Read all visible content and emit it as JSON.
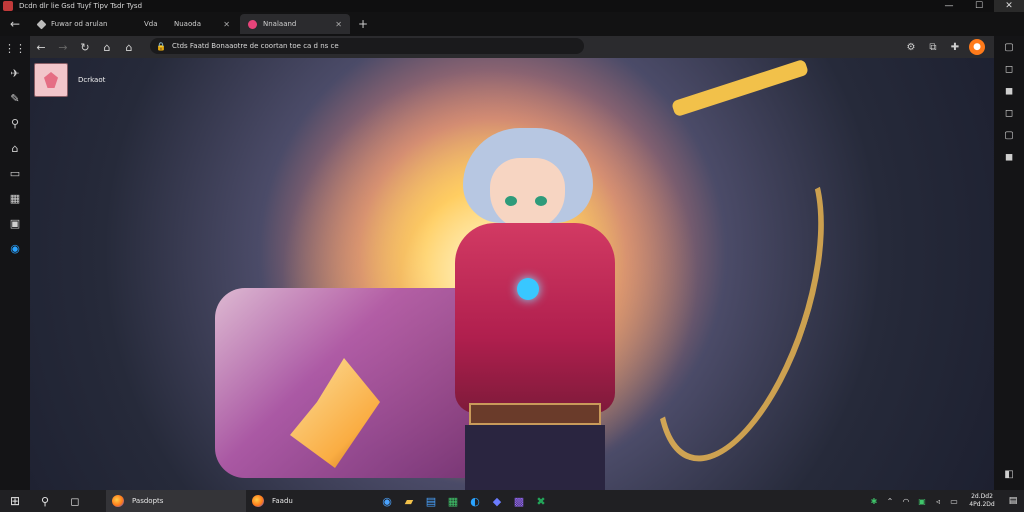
{
  "window": {
    "title": "Dcdn dlr lie Gsd  Tuyf Tipv Tsdr Tysd",
    "controls": {
      "minimize": "—",
      "maximize": "☐",
      "close": "✕"
    }
  },
  "tabs": [
    {
      "label": "Fuwar od arulan",
      "active": false
    },
    {
      "label": "Vda",
      "active": false
    },
    {
      "label": "Nuaoda",
      "active": false
    },
    {
      "label": "Nnalaand",
      "active": true
    }
  ],
  "navbar": {
    "url": "Ctds Faatd Bonaaotre de coortan toe ca d ns ce"
  },
  "site": {
    "label": "Dcrkaot"
  },
  "taskbar": {
    "tasks": [
      {
        "label": "Pasdopts",
        "active": true
      },
      {
        "label": "Faadu",
        "active": false
      }
    ],
    "clock": {
      "time": "2d.Dd2",
      "date": "4Pd.2Dd"
    }
  },
  "colors": {
    "accent_profile": "#ff7a1a",
    "tab_active": "#2b2b2e",
    "gem": "#38c7ff",
    "armor": "#d23a63"
  }
}
